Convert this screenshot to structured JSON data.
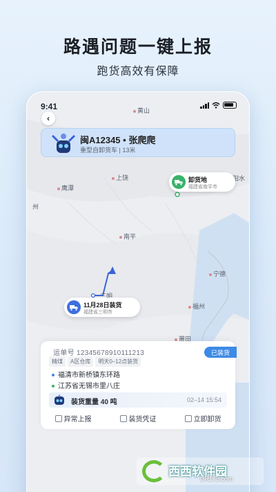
{
  "promo": {
    "headline": "路遇问题一键上报",
    "subline": "跑货高效有保障"
  },
  "status_bar": {
    "time": "9:41"
  },
  "driver": {
    "name": "闽A12345 • 张爬爬",
    "meta": "重型自卸货车 | 13米"
  },
  "map": {
    "places": [
      "黄山",
      "上饶",
      "鹰潭",
      "南平",
      "三明",
      "福州",
      "宁德",
      "莆田",
      "州",
      "阳水"
    ],
    "unload": {
      "title": "卸货地",
      "subtitle": "福建省南平市"
    },
    "load": {
      "title": "11月28日装货",
      "subtitle": "福建省三明市"
    }
  },
  "order": {
    "waybill": "运单号 12345678910111213",
    "badge": "已装货",
    "tags": [
      "精煤",
      "A区仓库",
      "明天0–12点装货"
    ],
    "from": "福清市新桥镇东环路",
    "to": "江苏省无锡市里八庄",
    "weight": "装货重量 40 吨",
    "datetime": "02–14 15:54",
    "actions": [
      "异常上报",
      "装货凭证",
      "立即卸货"
    ]
  },
  "watermark": {
    "text": "西西软件园",
    "url": "CR173.com"
  },
  "colors": {
    "accent": "#3d8ae6",
    "route": "#3b63d6",
    "green": "#39b26a"
  }
}
